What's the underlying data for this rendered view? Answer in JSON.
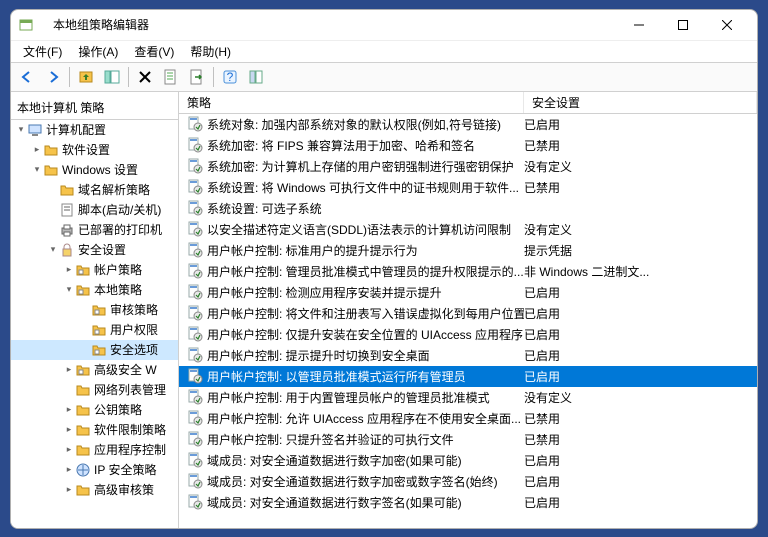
{
  "window": {
    "title": "本地组策略编辑器"
  },
  "menubar": [
    "文件(F)",
    "操作(A)",
    "查看(V)",
    "帮助(H)"
  ],
  "tree": {
    "header": "本地计算机 策略",
    "nodes": [
      {
        "depth": 0,
        "exp": "open",
        "icon": "computer",
        "label": "计算机配置"
      },
      {
        "depth": 1,
        "exp": "closed",
        "icon": "folder",
        "label": "软件设置"
      },
      {
        "depth": 1,
        "exp": "open",
        "icon": "folder",
        "label": "Windows 设置"
      },
      {
        "depth": 2,
        "exp": "none",
        "icon": "folder",
        "label": "域名解析策略"
      },
      {
        "depth": 2,
        "exp": "none",
        "icon": "script",
        "label": "脚本(启动/关机)"
      },
      {
        "depth": 2,
        "exp": "none",
        "icon": "printer",
        "label": "已部署的打印机"
      },
      {
        "depth": 2,
        "exp": "open",
        "icon": "lock",
        "label": "安全设置"
      },
      {
        "depth": 3,
        "exp": "closed",
        "icon": "folder2",
        "label": "帐户策略"
      },
      {
        "depth": 3,
        "exp": "open",
        "icon": "folder2",
        "label": "本地策略"
      },
      {
        "depth": 4,
        "exp": "none",
        "icon": "folder2",
        "label": "审核策略"
      },
      {
        "depth": 4,
        "exp": "none",
        "icon": "folder2",
        "label": "用户权限"
      },
      {
        "depth": 4,
        "exp": "none",
        "icon": "folder2",
        "label": "安全选项",
        "sel": true
      },
      {
        "depth": 3,
        "exp": "closed",
        "icon": "folder2",
        "label": "高级安全 W"
      },
      {
        "depth": 3,
        "exp": "none",
        "icon": "folder",
        "label": "网络列表管理"
      },
      {
        "depth": 3,
        "exp": "closed",
        "icon": "folder",
        "label": "公钥策略"
      },
      {
        "depth": 3,
        "exp": "closed",
        "icon": "folder",
        "label": "软件限制策略"
      },
      {
        "depth": 3,
        "exp": "closed",
        "icon": "folder",
        "label": "应用程序控制"
      },
      {
        "depth": 3,
        "exp": "closed",
        "icon": "ipsec",
        "label": "IP 安全策略"
      },
      {
        "depth": 3,
        "exp": "closed",
        "icon": "folder",
        "label": "高级审核策"
      }
    ]
  },
  "list": {
    "headers": {
      "policy": "策略",
      "setting": "安全设置"
    },
    "rows": [
      {
        "policy": "系统对象: 加强内部系统对象的默认权限(例如,符号链接)",
        "setting": "已启用"
      },
      {
        "policy": "系统加密: 将 FIPS 兼容算法用于加密、哈希和签名",
        "setting": "已禁用"
      },
      {
        "policy": "系统加密: 为计算机上存储的用户密钥强制进行强密钥保护",
        "setting": "没有定义"
      },
      {
        "policy": "系统设置: 将 Windows 可执行文件中的证书规则用于软件...",
        "setting": "已禁用"
      },
      {
        "policy": "系统设置: 可选子系统",
        "setting": ""
      },
      {
        "policy": "以安全描述符定义语言(SDDL)语法表示的计算机访问限制",
        "setting": "没有定义"
      },
      {
        "policy": "用户帐户控制: 标准用户的提升提示行为",
        "setting": "提示凭据"
      },
      {
        "policy": "用户帐户控制: 管理员批准模式中管理员的提升权限提示的...",
        "setting": "非 Windows 二进制文..."
      },
      {
        "policy": "用户帐户控制: 检测应用程序安装并提示提升",
        "setting": "已启用"
      },
      {
        "policy": "用户帐户控制: 将文件和注册表写入错误虚拟化到每用户位置",
        "setting": "已启用"
      },
      {
        "policy": "用户帐户控制: 仅提升安装在安全位置的 UIAccess 应用程序",
        "setting": "已启用"
      },
      {
        "policy": "用户帐户控制: 提示提升时切换到安全桌面",
        "setting": "已启用"
      },
      {
        "policy": "用户帐户控制: 以管理员批准模式运行所有管理员",
        "setting": "已启用",
        "selected": true
      },
      {
        "policy": "用户帐户控制: 用于内置管理员帐户的管理员批准模式",
        "setting": "没有定义"
      },
      {
        "policy": "用户帐户控制: 允许 UIAccess 应用程序在不使用安全桌面...",
        "setting": "已禁用"
      },
      {
        "policy": "用户帐户控制: 只提升签名并验证的可执行文件",
        "setting": "已禁用"
      },
      {
        "policy": "域成员: 对安全通道数据进行数字加密(如果可能)",
        "setting": "已启用"
      },
      {
        "policy": "域成员: 对安全通道数据进行数字加密或数字签名(始终)",
        "setting": "已启用"
      },
      {
        "policy": "域成员: 对安全通道数据进行数字签名(如果可能)",
        "setting": "已启用"
      }
    ]
  }
}
